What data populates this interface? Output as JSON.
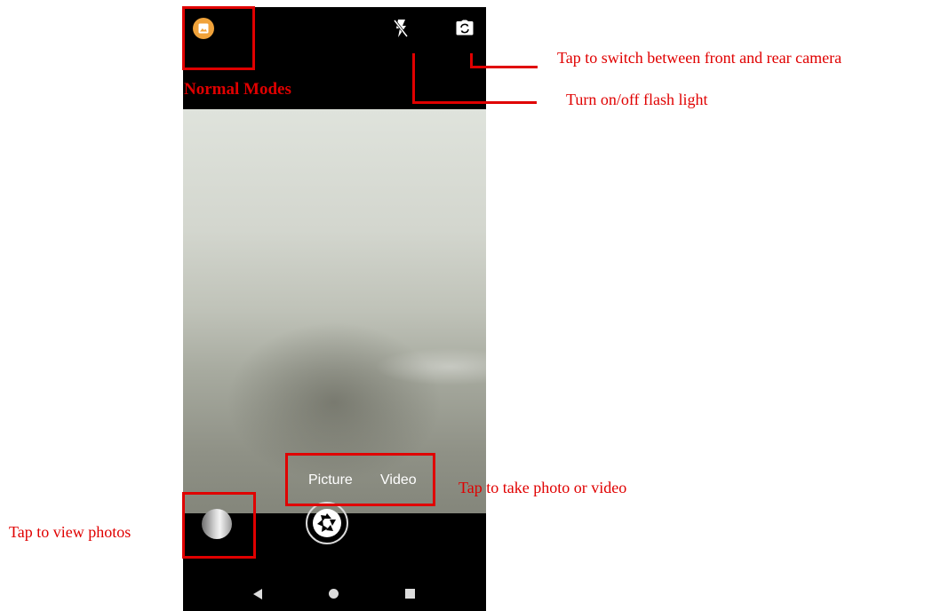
{
  "camera": {
    "modes": [
      "Picture",
      "Video"
    ]
  },
  "icons": {
    "gallery": "gallery-icon",
    "flash": "flash-off-icon",
    "switch_camera": "switch-camera-icon",
    "thumbnail": "photo-thumbnail",
    "shutter": "shutter-icon",
    "nav_back": "back-triangle-icon",
    "nav_home": "home-circle-icon",
    "nav_recent": "recent-square-icon"
  },
  "annotations": {
    "title": "Normal Modes",
    "switch_camera": "Tap to switch between front and rear camera",
    "flash": "Turn on/off flash light",
    "take_photo_video": "Tap to take photo or video",
    "view_photos": "Tap to view photos"
  },
  "colors": {
    "annotation_red": "#e00000",
    "gallery_orange": "#f0a23a",
    "screen_black": "#000000"
  }
}
